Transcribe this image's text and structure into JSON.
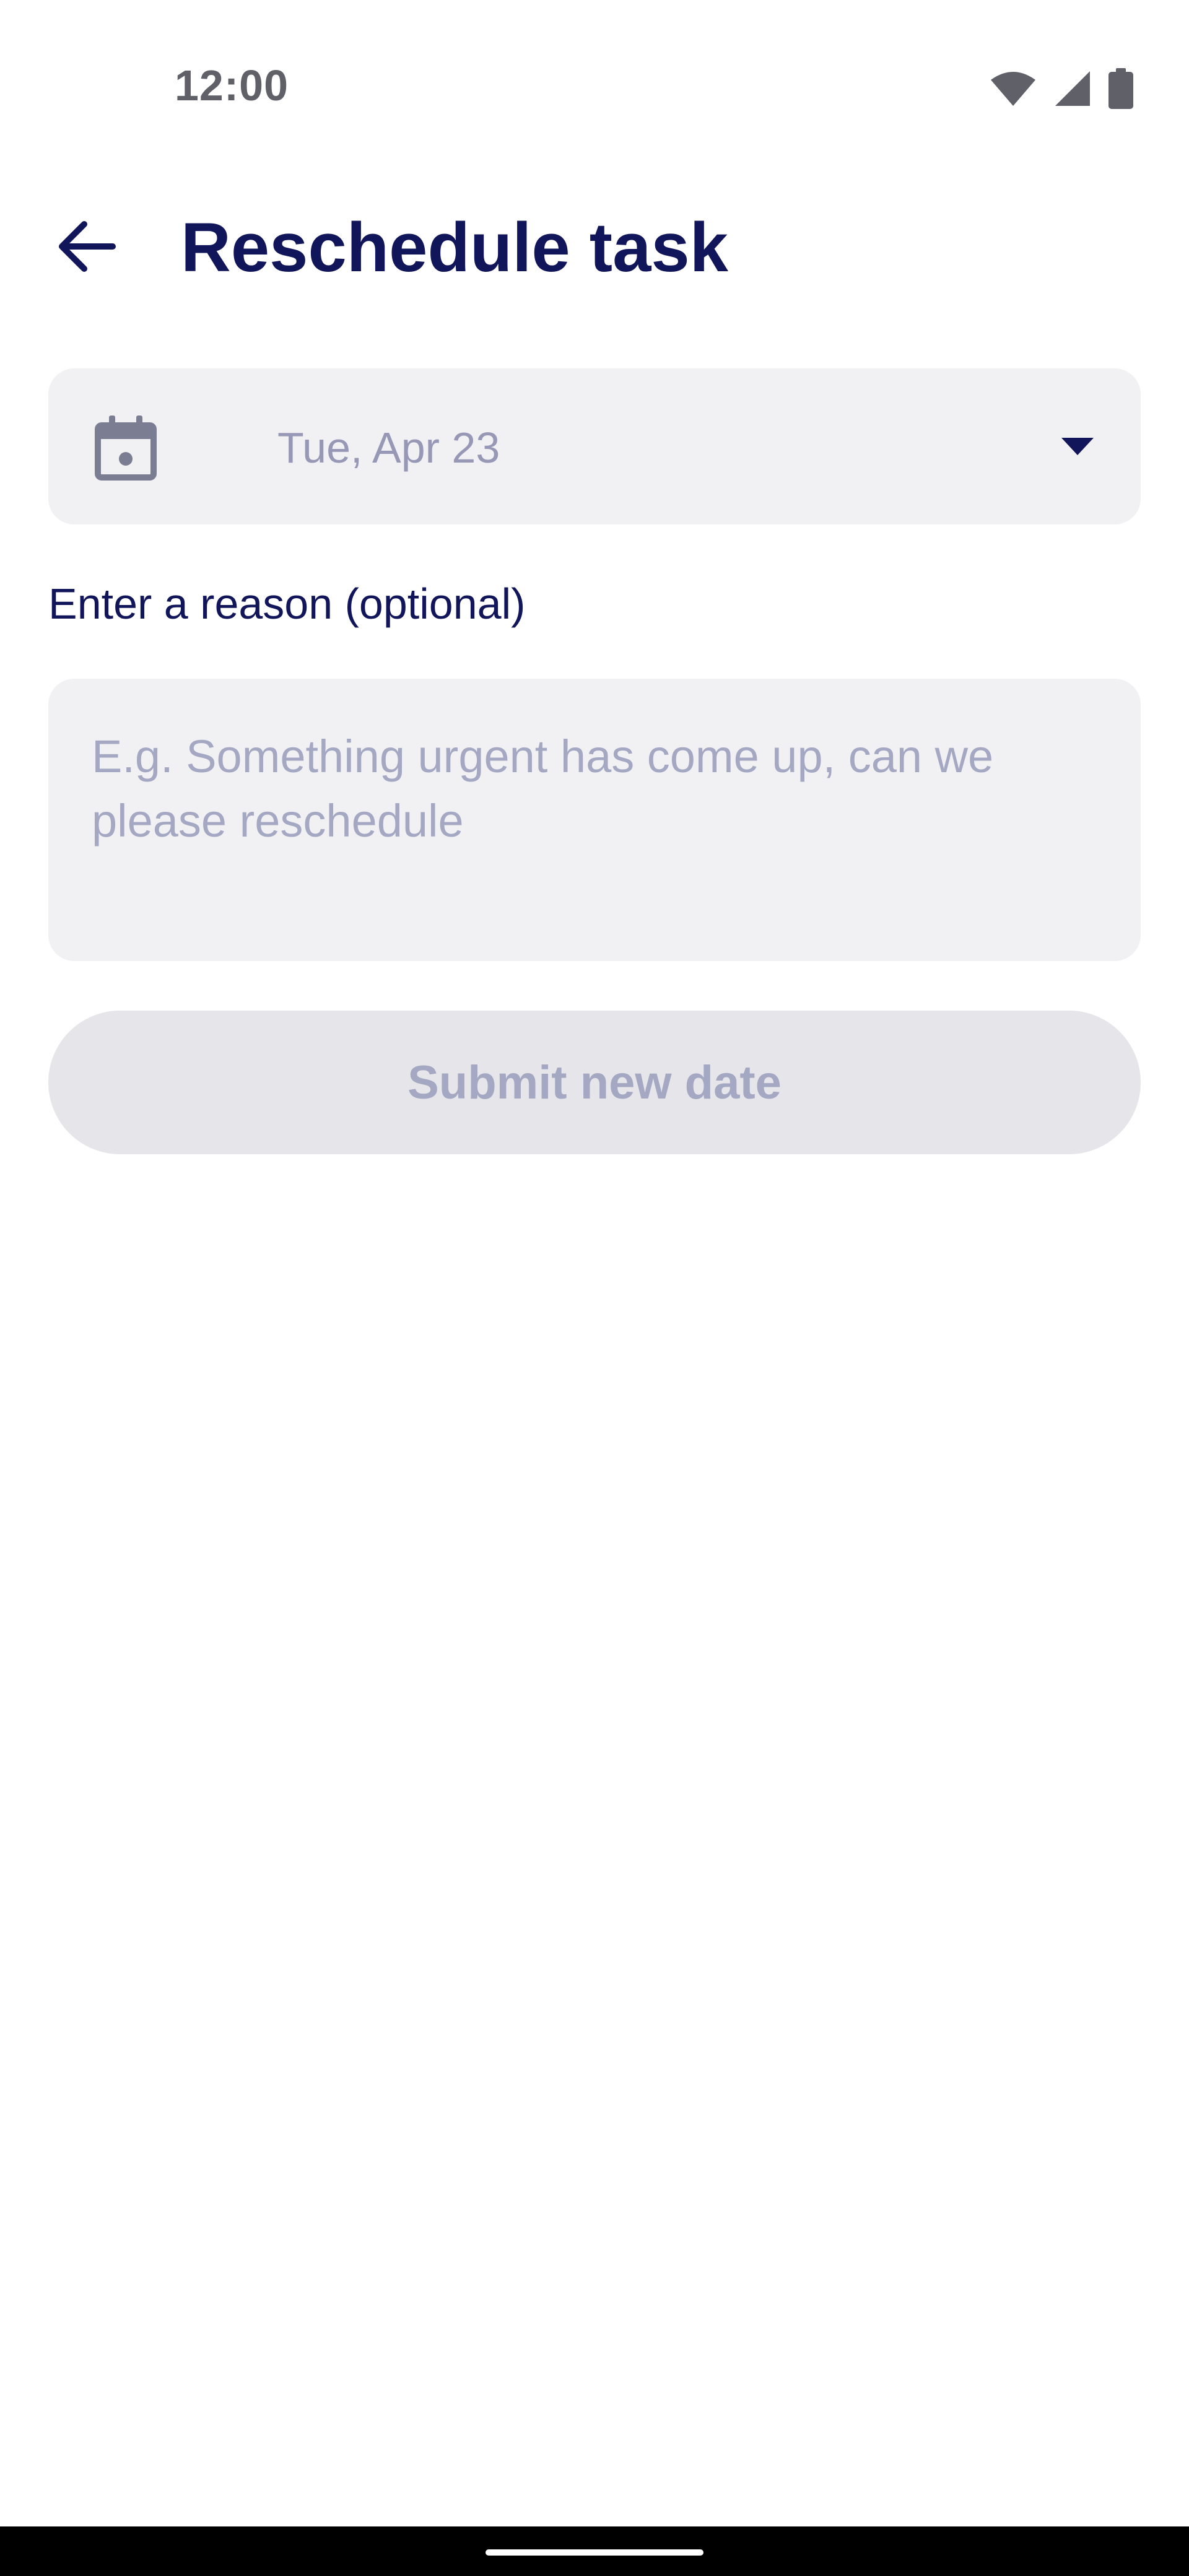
{
  "status_bar": {
    "time": "12:00",
    "icons": [
      "wifi-icon",
      "cellular-signal-icon",
      "battery-icon"
    ]
  },
  "app_bar": {
    "back_icon": "arrow-left-icon",
    "title": "Reschedule task"
  },
  "date_field": {
    "icon": "calendar-icon",
    "value": "Tue, Apr 23",
    "dropdown_icon": "caret-down-icon"
  },
  "reason": {
    "label": "Enter a reason (optional)",
    "placeholder": "E.g. Something urgent has come up, can we please reschedule",
    "value": ""
  },
  "submit": {
    "label": "Submit new date",
    "enabled": false
  },
  "colors": {
    "primary_text": "#111559",
    "field_background": "#f1f1f4",
    "placeholder_text": "#a5a8c2",
    "disabled_button": "#e5e5ea",
    "status_text": "#5f6068"
  }
}
